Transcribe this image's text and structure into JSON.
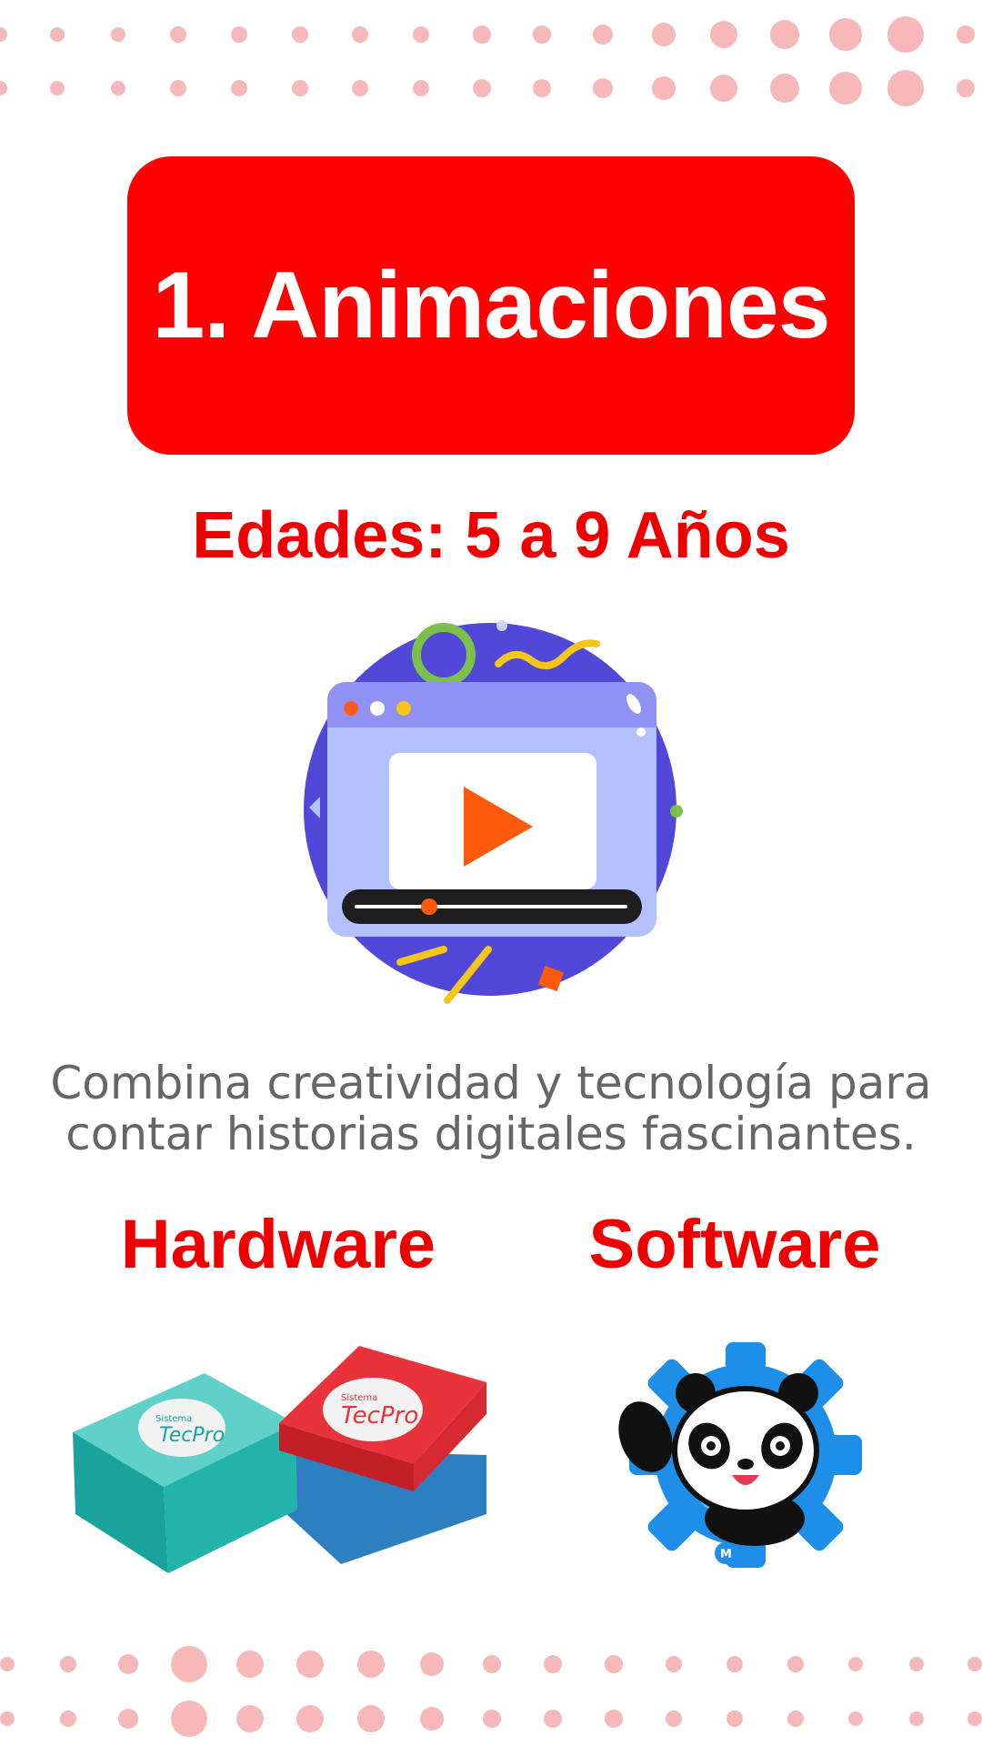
{
  "header": {
    "title": "1. Animaciones"
  },
  "ages": "Edades: 5 a 9 Años",
  "description": {
    "line1": "Combina creatividad y tecnología para",
    "line2": "contar historias digitales fascinantes."
  },
  "columns": {
    "hardware": {
      "label": "Hardware",
      "box_brand": "TecPro",
      "box_prefix": "Sistema"
    },
    "software": {
      "label": "Software",
      "mascot_badge": "M"
    }
  },
  "colors": {
    "accent": "#ff0000",
    "dots": "#f6b4b4",
    "text_gray": "#666666",
    "illustration_circle": "#5148d9"
  },
  "icons": [
    "dotted-pattern",
    "video-player-icon",
    "play-icon",
    "tecpro-boxes-image",
    "panda-mascot-icon"
  ]
}
